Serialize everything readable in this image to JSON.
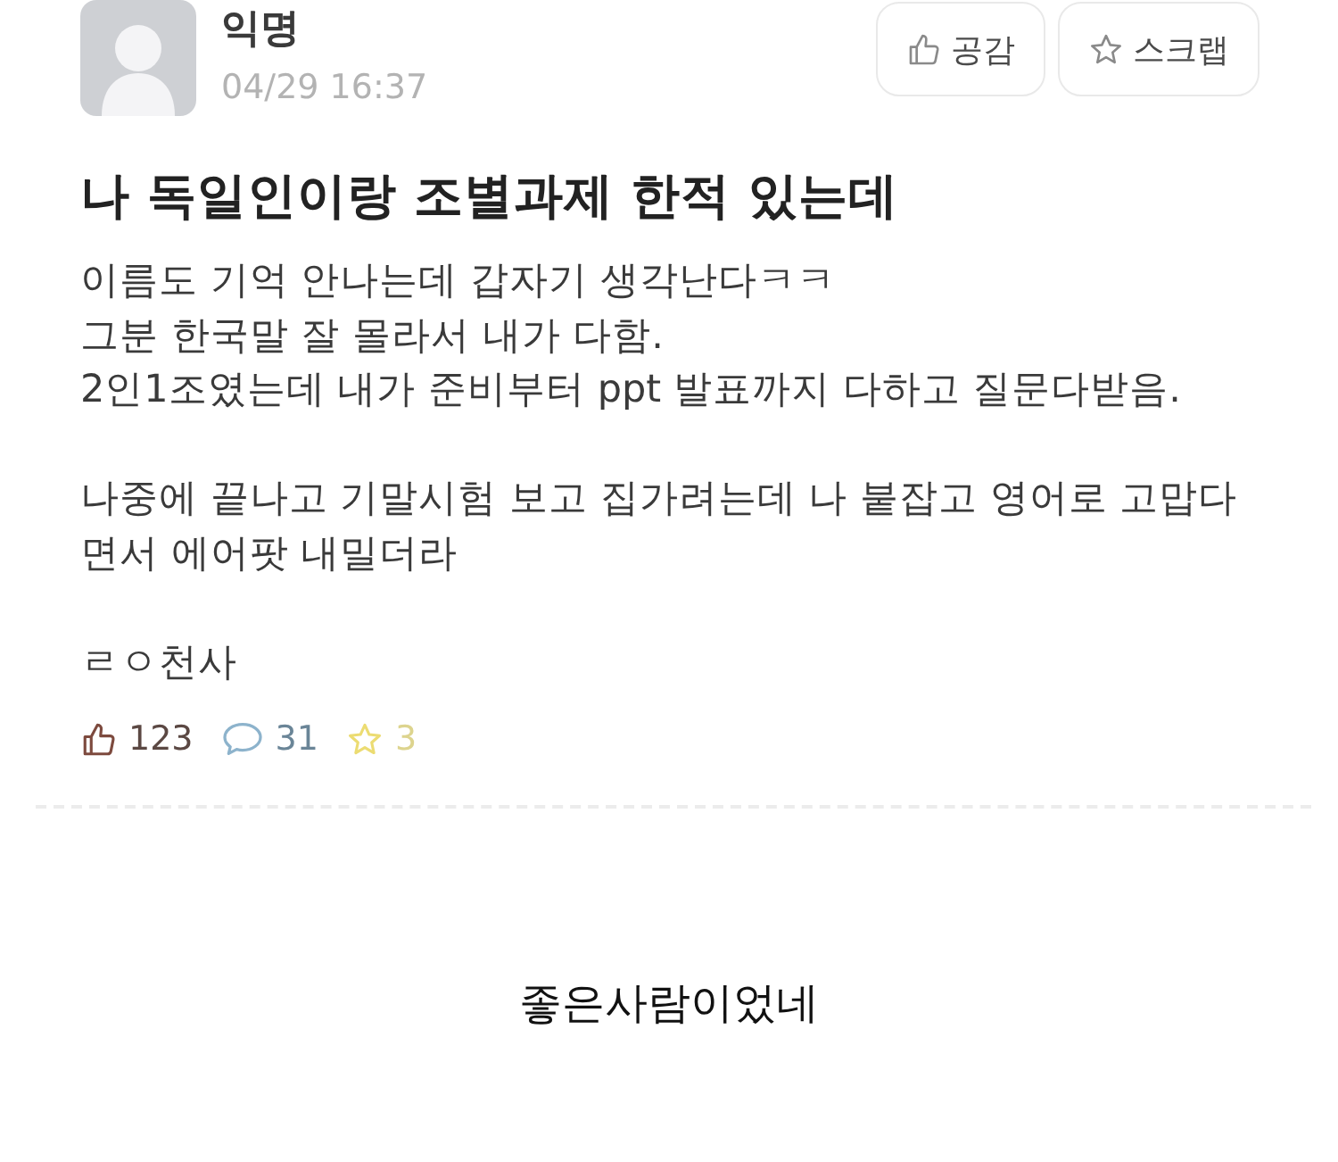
{
  "post": {
    "author": "익명",
    "date": "04/29 16:37",
    "buttons": [
      {
        "kind": "like",
        "label": "공감"
      },
      {
        "kind": "scrap",
        "label": "스크랩"
      }
    ],
    "title": "나 독일인이랑 조별과제 한적 있는데",
    "body": [
      "이름도 기억 안나는데 갑자기 생각난다ㅋㅋ\n그분 한국말 잘 몰라서 내가 다함.\n2인1조였는데 내가 준비부터 ppt 발표까지 다하고 질문다받음.",
      "나중에 끝나고 기말시험 보고 집가려는데 나 붙잡고 영어로 고맙다\n면서 에어팟 내밀더라",
      "ㄹㅇ천사"
    ],
    "stats": [
      {
        "kind": "likes",
        "count": "123"
      },
      {
        "kind": "comments",
        "count": "31"
      },
      {
        "kind": "scraps",
        "count": "3"
      }
    ]
  },
  "caption": "좋은사람이었네"
}
